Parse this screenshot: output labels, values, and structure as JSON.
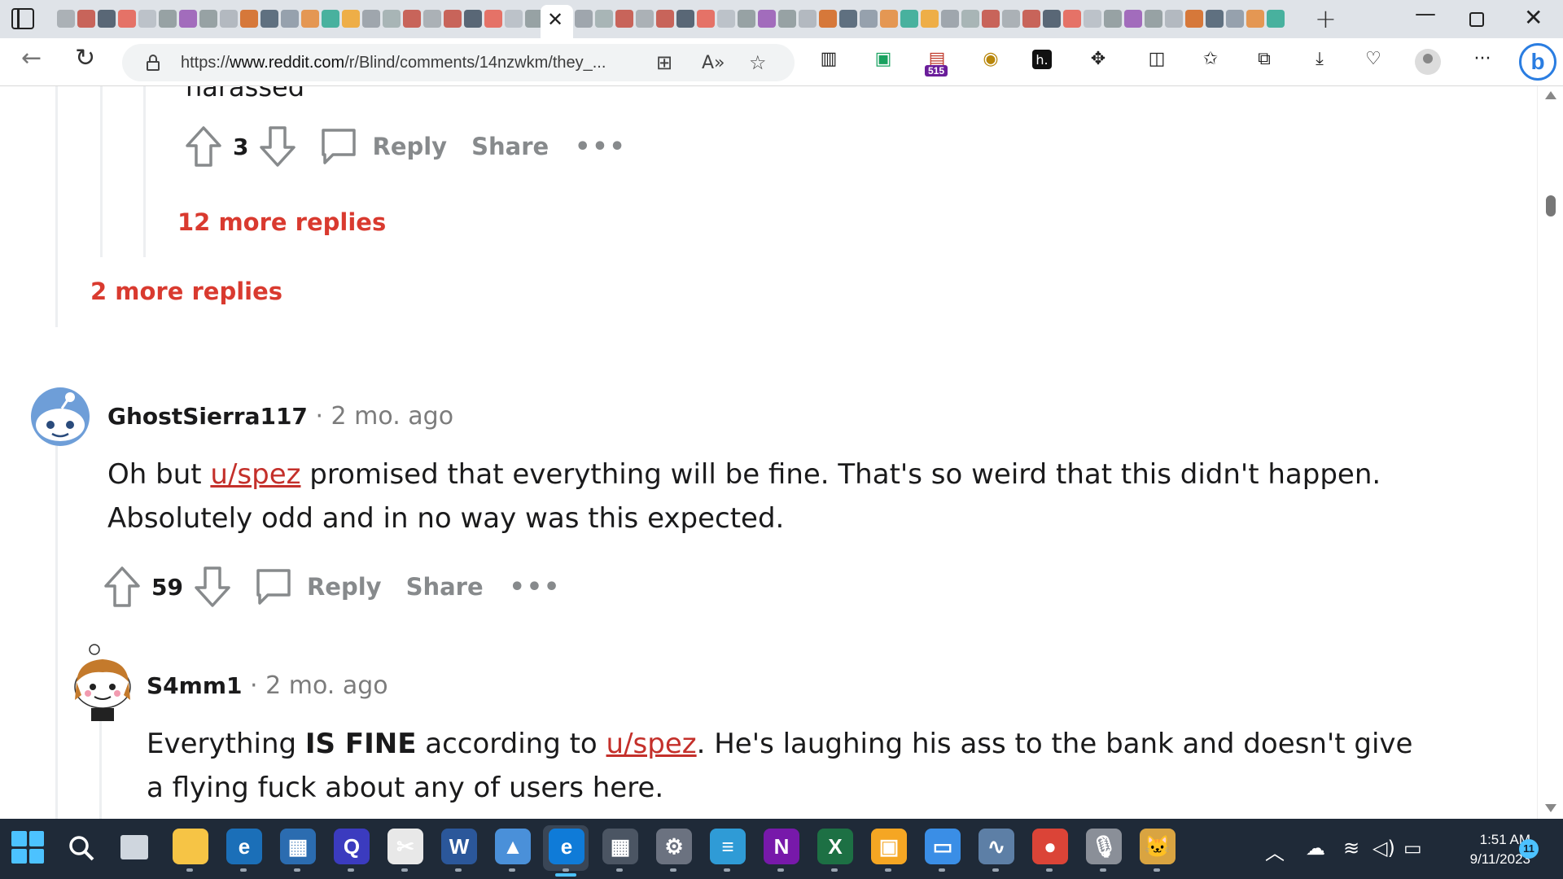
{
  "browser": {
    "url_prefix": "https://",
    "url_host": "www.reddit.com",
    "url_path": "/r/Blind/comments/14nzwkm/they_...",
    "extension_badge": "515",
    "bing_label": "b"
  },
  "page": {
    "cut_text": "harassed",
    "comment0": {
      "votes": "3",
      "reply": "Reply",
      "share": "Share",
      "more": "•••"
    },
    "more_replies_1": "12 more replies",
    "more_replies_2": "2 more replies",
    "comment1": {
      "username": "GhostSierra117",
      "age": " · 2 mo. ago",
      "text_before": "Oh but ",
      "mention": "u/spez",
      "text_after": " promised that everything will be fine. That's so weird that this didn't happen. Absolutely odd and in no way was this expected.",
      "votes": "59",
      "reply": "Reply",
      "share": "Share",
      "more": "•••"
    },
    "comment2": {
      "username": "S4mm1",
      "age": " · 2 mo. ago",
      "text_before": "Everything ",
      "text_bold": "IS FINE",
      "text_mid": " according to ",
      "mention": "u/spez",
      "text_after": ". He's laughing his ass to the bank and doesn't give a flying fuck about any of users here."
    }
  },
  "taskbar": {
    "time": "1:51 AM",
    "date": "9/11/2023",
    "notifications": "11",
    "apps": [
      {
        "name": "file-explorer",
        "color": "#f6c445",
        "label": ""
      },
      {
        "name": "edge-dev",
        "color": "#1b6fb8",
        "label": "e"
      },
      {
        "name": "microsoft-store",
        "color": "#2b6cb0",
        "label": "▦"
      },
      {
        "name": "search-app",
        "color": "#3b3bbf",
        "label": "Q"
      },
      {
        "name": "snipping-tool",
        "color": "#e8e8e8",
        "label": "✂"
      },
      {
        "name": "word",
        "color": "#2b579a",
        "label": "W"
      },
      {
        "name": "photos",
        "color": "#4a90d9",
        "label": "▲"
      },
      {
        "name": "edge",
        "color": "#0f7bd8",
        "label": "e"
      },
      {
        "name": "calculator",
        "color": "#4b5563",
        "label": "▦"
      },
      {
        "name": "settings",
        "color": "#6b7280",
        "label": "⚙"
      },
      {
        "name": "notepad",
        "color": "#2f9bd6",
        "label": "≡"
      },
      {
        "name": "onenote",
        "color": "#7719aa",
        "label": "N"
      },
      {
        "name": "excel",
        "color": "#1d7044",
        "label": "X"
      },
      {
        "name": "sticky-app",
        "color": "#f5a623",
        "label": "▣"
      },
      {
        "name": "remote-desktop",
        "color": "#3a8ee6",
        "label": "▭"
      },
      {
        "name": "performance-monitor",
        "color": "#5d7fa6",
        "label": "∿"
      },
      {
        "name": "chrome",
        "color": "#db4437",
        "label": "●"
      },
      {
        "name": "voice-recorder",
        "color": "#8a8f98",
        "label": "🎙"
      },
      {
        "name": "cat-app",
        "color": "#d9a441",
        "label": "🐱"
      }
    ]
  }
}
